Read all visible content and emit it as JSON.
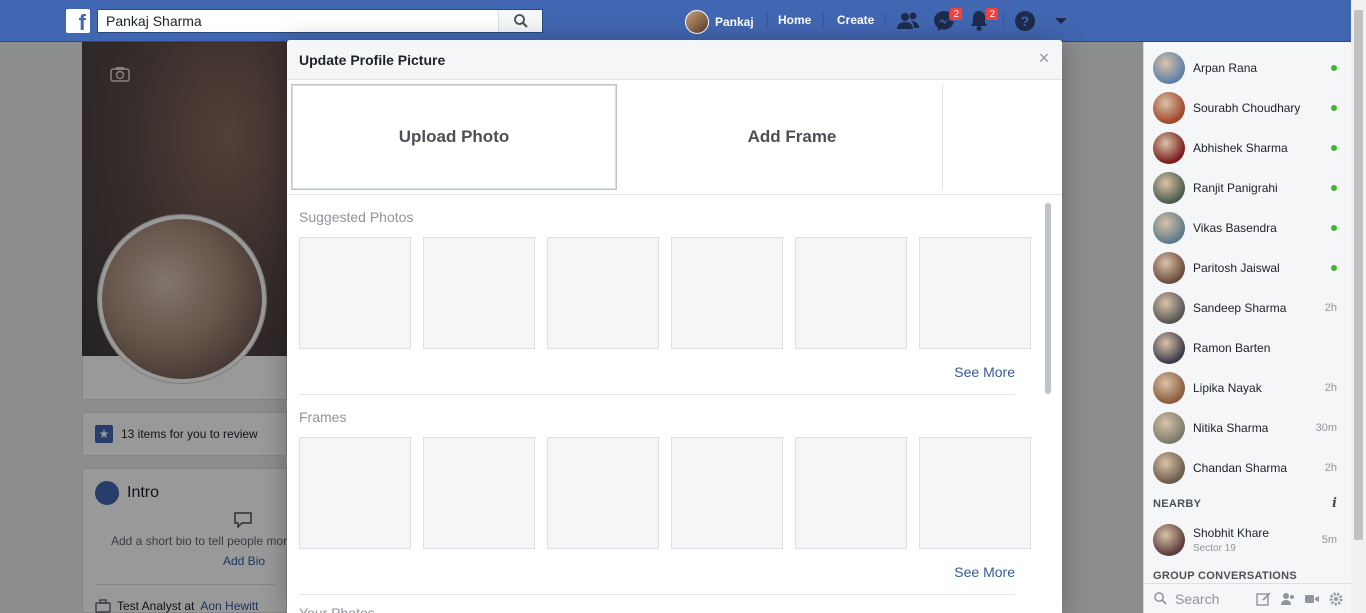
{
  "topbar": {
    "search_value": "Pankaj Sharma",
    "user_name": "Pankaj",
    "home_label": "Home",
    "create_label": "Create",
    "messages_badge": "2",
    "notifications_badge": "2"
  },
  "profile": {
    "review_text": "13 items for you to review",
    "intro_title": "Intro",
    "bio_prompt": "Add a short bio to tell people mor",
    "add_bio": "Add Bio",
    "work_prefix": "Test Analyst at",
    "work_company": "Aon Hewitt"
  },
  "modal": {
    "title": "Update Profile Picture",
    "close_symbol": "×",
    "tabs": [
      {
        "label": "Upload Photo"
      },
      {
        "label": "Add Frame"
      }
    ],
    "suggested_label": "Suggested Photos",
    "frames_label": "Frames",
    "next_section_label": "Your Photos",
    "see_more": "See More"
  },
  "chat": {
    "contacts": [
      {
        "name": "Arpan Rana",
        "status": "online",
        "color": "#5b7fa8"
      },
      {
        "name": "Sourabh Choudhary",
        "status": "online",
        "color": "#a0452a"
      },
      {
        "name": "Abhishek Sharma",
        "status": "online",
        "color": "#7a1a1a"
      },
      {
        "name": "Ranjit Panigrahi",
        "status": "online",
        "color": "#4a5a4a"
      },
      {
        "name": "Vikas Basendra",
        "status": "online",
        "color": "#5a7a8a"
      },
      {
        "name": "Paritosh Jaiswal",
        "status": "online",
        "color": "#6a4a3a"
      },
      {
        "name": "Sandeep Sharma",
        "status": "2h",
        "color": "#555555"
      },
      {
        "name": "Ramon Barten",
        "status": "",
        "color": "#3a3a4a"
      },
      {
        "name": "Lipika Nayak",
        "status": "2h",
        "color": "#8a5a3a"
      },
      {
        "name": "Nitika Sharma",
        "status": "30m",
        "color": "#7a7a6a"
      },
      {
        "name": "Chandan Sharma",
        "status": "2h",
        "color": "#6a5a4a"
      }
    ],
    "nearby_label": "NEARBY",
    "nearby": {
      "name": "Shobhit Khare",
      "sub": "Sector 19",
      "status": "5m",
      "color": "#5a3a3a"
    },
    "group_label": "GROUP CONVERSATIONS",
    "search_placeholder": "Search"
  }
}
